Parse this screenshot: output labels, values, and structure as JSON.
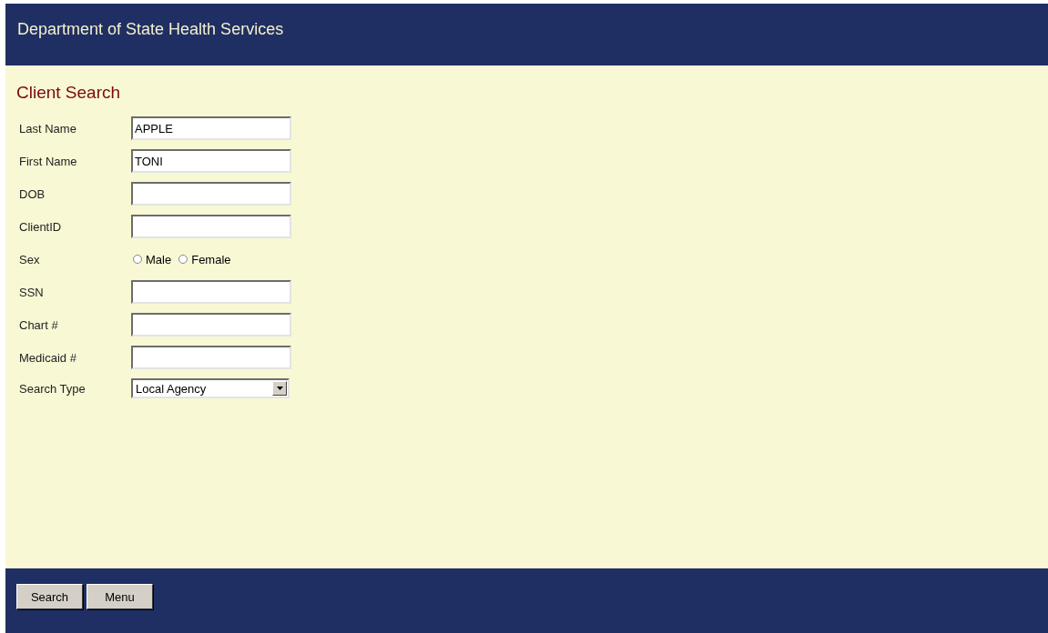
{
  "header": {
    "title": "Department of State Health Services"
  },
  "page_title": "Client Search",
  "fields": [
    {
      "kind": "text",
      "label": "Last Name",
      "value": "APPLE"
    },
    {
      "kind": "text",
      "label": "First Name",
      "value": "TONI"
    },
    {
      "kind": "text",
      "label": "DOB"
    },
    {
      "kind": "text",
      "label": "ClientID"
    },
    {
      "kind": "radio",
      "label": "Sex",
      "options": [
        {
          "label": "Male",
          "selected": false
        },
        {
          "label": "Female",
          "selected": false
        }
      ]
    },
    {
      "kind": "text",
      "label": "SSN"
    },
    {
      "kind": "text",
      "label": "Chart #"
    },
    {
      "kind": "text",
      "label": "Medicaid #"
    },
    {
      "kind": "select",
      "label": "Search Type",
      "value": "Local Agency"
    }
  ],
  "buttons": [
    {
      "label": "Search"
    },
    {
      "label": "Menu"
    }
  ]
}
